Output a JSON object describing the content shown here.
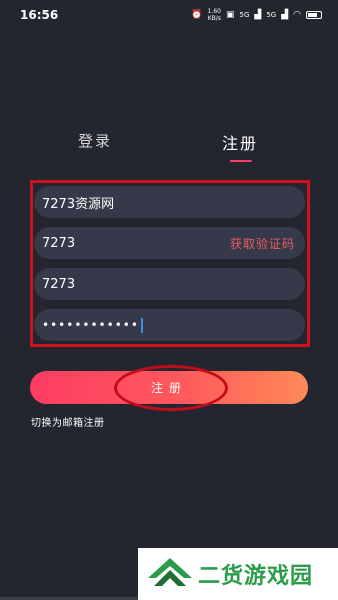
{
  "status_bar": {
    "time": "16:56",
    "net_speed_value": "1.60",
    "net_speed_unit": "KB/s",
    "signal_1": "5G",
    "signal_2": "5G"
  },
  "tabs": [
    {
      "label": "登录",
      "active": false
    },
    {
      "label": "注册",
      "active": true
    }
  ],
  "form": {
    "username": "7273资源网",
    "phone": "7273",
    "verify_code": "7273",
    "password_masked": "••••••••••••",
    "get_code_label": "获取验证码"
  },
  "register_button_label": "注册",
  "switch_email_label": "切换为邮箱注册",
  "watermark": {
    "text": "二货游戏园",
    "color": "#2a9d4a"
  },
  "colors": {
    "background": "#23252f",
    "field": "#363949",
    "accent_red": "#fe3c62",
    "accent_orange": "#ff8a57",
    "highlight": "#d1101f"
  }
}
